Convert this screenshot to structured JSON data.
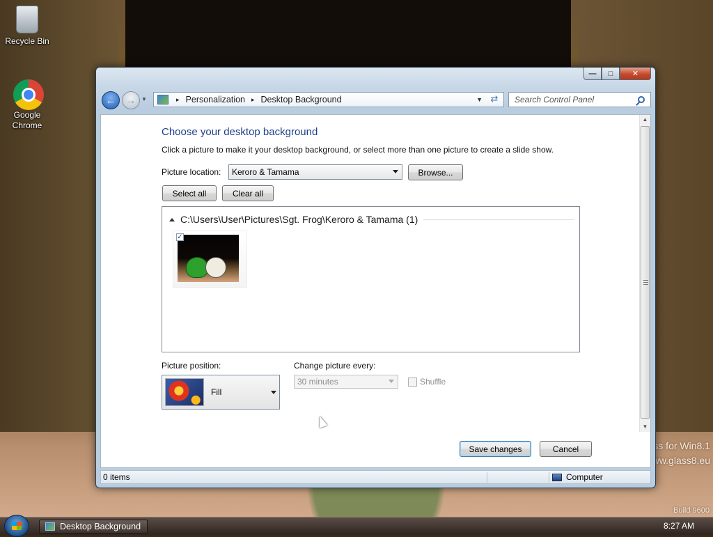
{
  "desktop": {
    "icons": [
      {
        "label": "Recycle Bin"
      },
      {
        "label": "Google Chrome"
      }
    ],
    "watermark": {
      "line1": "ss for Win8.1",
      "line2": "www.glass8.eu",
      "build": "Build 9600"
    }
  },
  "window": {
    "caption_buttons": {
      "minimize": "—",
      "maximize": "□",
      "close": "✕"
    },
    "address": {
      "crumbs": [
        "Personalization",
        "Desktop Background"
      ]
    },
    "search": {
      "placeholder": "Search Control Panel"
    },
    "content": {
      "title": "Choose your desktop background",
      "description": "Click a picture to make it your desktop background, or select more than one picture to create a slide show.",
      "picture_location_label": "Picture location:",
      "picture_location_value": "Keroro & Tamama",
      "browse_label": "Browse...",
      "select_all_label": "Select all",
      "clear_all_label": "Clear all",
      "group_title": "C:\\Users\\User\\Pictures\\Sgt. Frog\\Keroro & Tamama (1)",
      "thumbnail_checked": true,
      "picture_position_label": "Picture position:",
      "picture_position_value": "Fill",
      "change_every_label": "Change picture every:",
      "change_every_value": "30 minutes",
      "shuffle_label": "Shuffle",
      "save_label": "Save changes",
      "cancel_label": "Cancel"
    },
    "status": {
      "items": "0 items",
      "location": "Computer"
    }
  },
  "taskbar": {
    "task_button": "Desktop Background",
    "clock": "8:27 AM"
  },
  "colors": {
    "title_blue": "#1e3e8c",
    "close_red": "#c44a2c"
  }
}
